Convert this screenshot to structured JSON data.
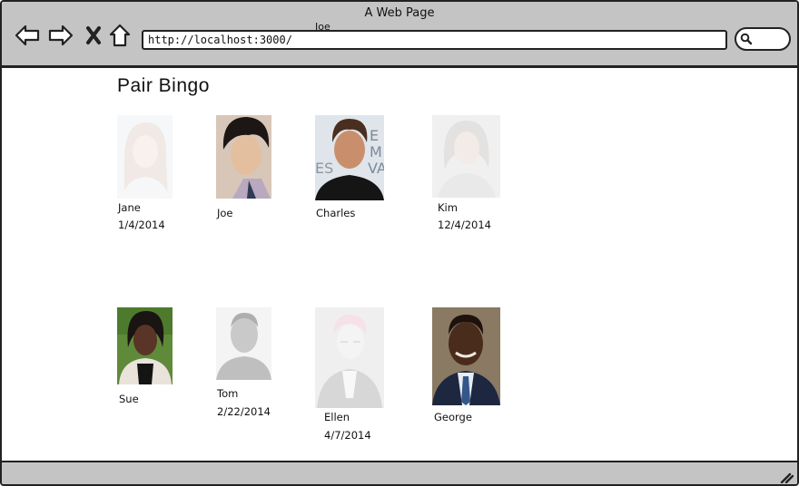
{
  "window": {
    "title": "A Web Page",
    "stray_label": "Joe"
  },
  "toolbar": {
    "back_icon": "back-arrow-icon",
    "forward_icon": "forward-arrow-icon",
    "stop_icon": "close-x-icon",
    "home_icon": "home-icon",
    "url": "http://localhost:3000/",
    "search_icon": "search-icon"
  },
  "page": {
    "title": "Pair Bingo"
  },
  "people": [
    {
      "name": "Jane",
      "date": "1/4/2014",
      "faded": true
    },
    {
      "name": "Joe",
      "date": "",
      "faded": false
    },
    {
      "name": "Charles",
      "date": "",
      "faded": false
    },
    {
      "name": "Kim",
      "date": "12/4/2014",
      "faded": true
    },
    {
      "name": "Sue",
      "date": "",
      "faded": false
    },
    {
      "name": "Tom",
      "date": "2/22/2014",
      "faded": true
    },
    {
      "name": "Ellen",
      "date": "4/7/2014",
      "faded": true
    },
    {
      "name": "George",
      "date": "",
      "faded": false
    }
  ],
  "colors": {
    "chrome": "#c4c4c4",
    "outline": "#222222"
  }
}
